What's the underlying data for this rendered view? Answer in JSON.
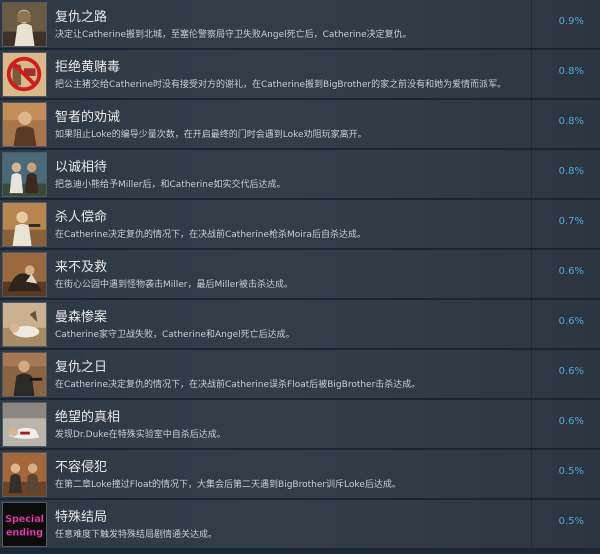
{
  "colors": {
    "background": "#1b2838",
    "title_text": "#e8e8e8",
    "desc_text": "#c9ced3",
    "percent_text": "#4fa6e0"
  },
  "achievements": [
    {
      "title": "复仇之路",
      "description": "决定让Catherine搬到北城，至塞伦警察局守卫失败Angel死亡后，Catherine决定复仇。",
      "percent": "0.9%",
      "icon": "catherine-portrait-icon"
    },
    {
      "title": "拒绝黄赌毒",
      "description": "把公主猪交给Catherine时没有接受对方的谢礼，在Catherine搬到BigBrother的家之前没有和她为爱情而派军。",
      "percent": "0.8%",
      "icon": "no-drugs-icon"
    },
    {
      "title": "智者的劝诫",
      "description": "如果阻止Loke的编导少量次数，在开启最终的门时会遇到Loke劝阻玩家离开。",
      "percent": "0.8%",
      "icon": "wise-man-icon"
    },
    {
      "title": "以诚相待",
      "description": "把急迪小熊给予Miller后，和Catherine如实交代后达成。",
      "percent": "0.8%",
      "icon": "two-people-icon"
    },
    {
      "title": "杀人偿命",
      "description": "在Catherine决定复仇的情况下，在决战前Catherine枪杀Moira后自杀达成。",
      "percent": "0.7%",
      "icon": "woman-gun-icon"
    },
    {
      "title": "来不及救",
      "description": "在街心公园中遇到怪物袭击Miller，最后Miller被击杀达成。",
      "percent": "0.6%",
      "icon": "monster-attack-icon"
    },
    {
      "title": "曼森惨案",
      "description": "Catherine家守卫战失败，Catherine和Angel死亡后达成。",
      "percent": "0.6%",
      "icon": "fallen-figure-icon"
    },
    {
      "title": "复仇之日",
      "description": "在Catherine决定复仇的情况下，在决战前Catherine误杀Float后被BigBrother击杀达成。",
      "percent": "0.6%",
      "icon": "armed-man-icon"
    },
    {
      "title": "绝望的真相",
      "description": "发现Dr.Duke在特殊实验室中自杀后达成。",
      "percent": "0.6%",
      "icon": "lab-body-icon"
    },
    {
      "title": "不容侵犯",
      "description": "在第二章Loke撞过Float的情况下，大集会后第二天遇到BigBrother训斥Loke后达成。",
      "percent": "0.5%",
      "icon": "confrontation-icon"
    },
    {
      "title": "特殊结局",
      "description": "任意难度下触发特殊结局剧情通关达成。",
      "percent": "0.5%",
      "icon": "special-ending-icon",
      "icon_text": [
        "Special",
        "ending"
      ]
    }
  ]
}
